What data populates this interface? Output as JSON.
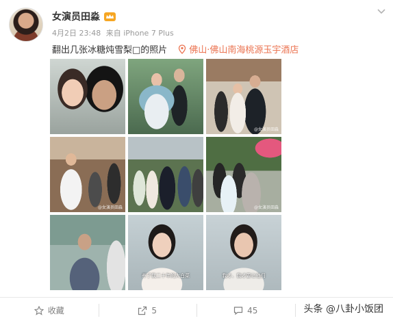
{
  "post": {
    "username": "女演员田淼",
    "time": "4月2日 23:48",
    "source": "来自 iPhone 7 Plus",
    "text": "翻出几张冰糖炖雪梨□的照片",
    "location": "佛山·佛山南海桃源玉宇酒店"
  },
  "photos": [
    {
      "wm": ""
    },
    {
      "wm": ""
    },
    {
      "wm": "@女演员田淼"
    },
    {
      "wm": "@女演员田淼"
    },
    {
      "wm": ""
    },
    {
      "wm": "@女演员田淼"
    },
    {
      "wm": ""
    },
    {
      "wm": "",
      "sub": "养了我二十年的大白菜"
    },
    {
      "wm": "",
      "sub": "我才、我才要让他们"
    }
  ],
  "actions": {
    "favorite_label": "收藏",
    "repost_count": "5",
    "comment_count": "45"
  },
  "watermark": "头条 @八卦小饭团",
  "colors": {
    "accent": "#eb7350",
    "muted": "#999999",
    "text": "#333333"
  }
}
